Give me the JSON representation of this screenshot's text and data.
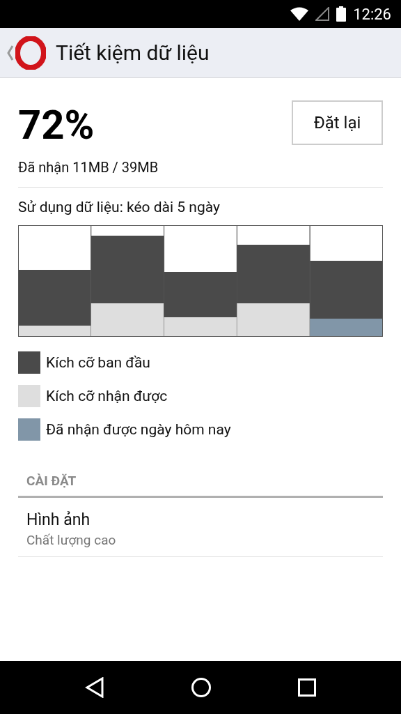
{
  "status_bar": {
    "time": "12:26"
  },
  "header": {
    "title": "Tiết kiệm dữ liệu"
  },
  "savings": {
    "percent": "72%",
    "received": "Đã nhận 11MB / 39MB",
    "reset_button": "Đặt lại"
  },
  "usage": {
    "title": "Sử dụng dữ liệu: kéo dài 5 ngày"
  },
  "legend": [
    {
      "label": "Kích cỡ ban đầu",
      "color": "#4a4a4a"
    },
    {
      "label": "Kích cỡ nhận được",
      "color": "#dedede"
    },
    {
      "label": "Đã nhận được ngày hôm nay",
      "color": "#8196a8"
    }
  ],
  "settings": {
    "heading": "CÀI ĐẶT",
    "items": [
      {
        "title": "Hình ảnh",
        "value": "Chất lượng cao"
      }
    ]
  }
}
